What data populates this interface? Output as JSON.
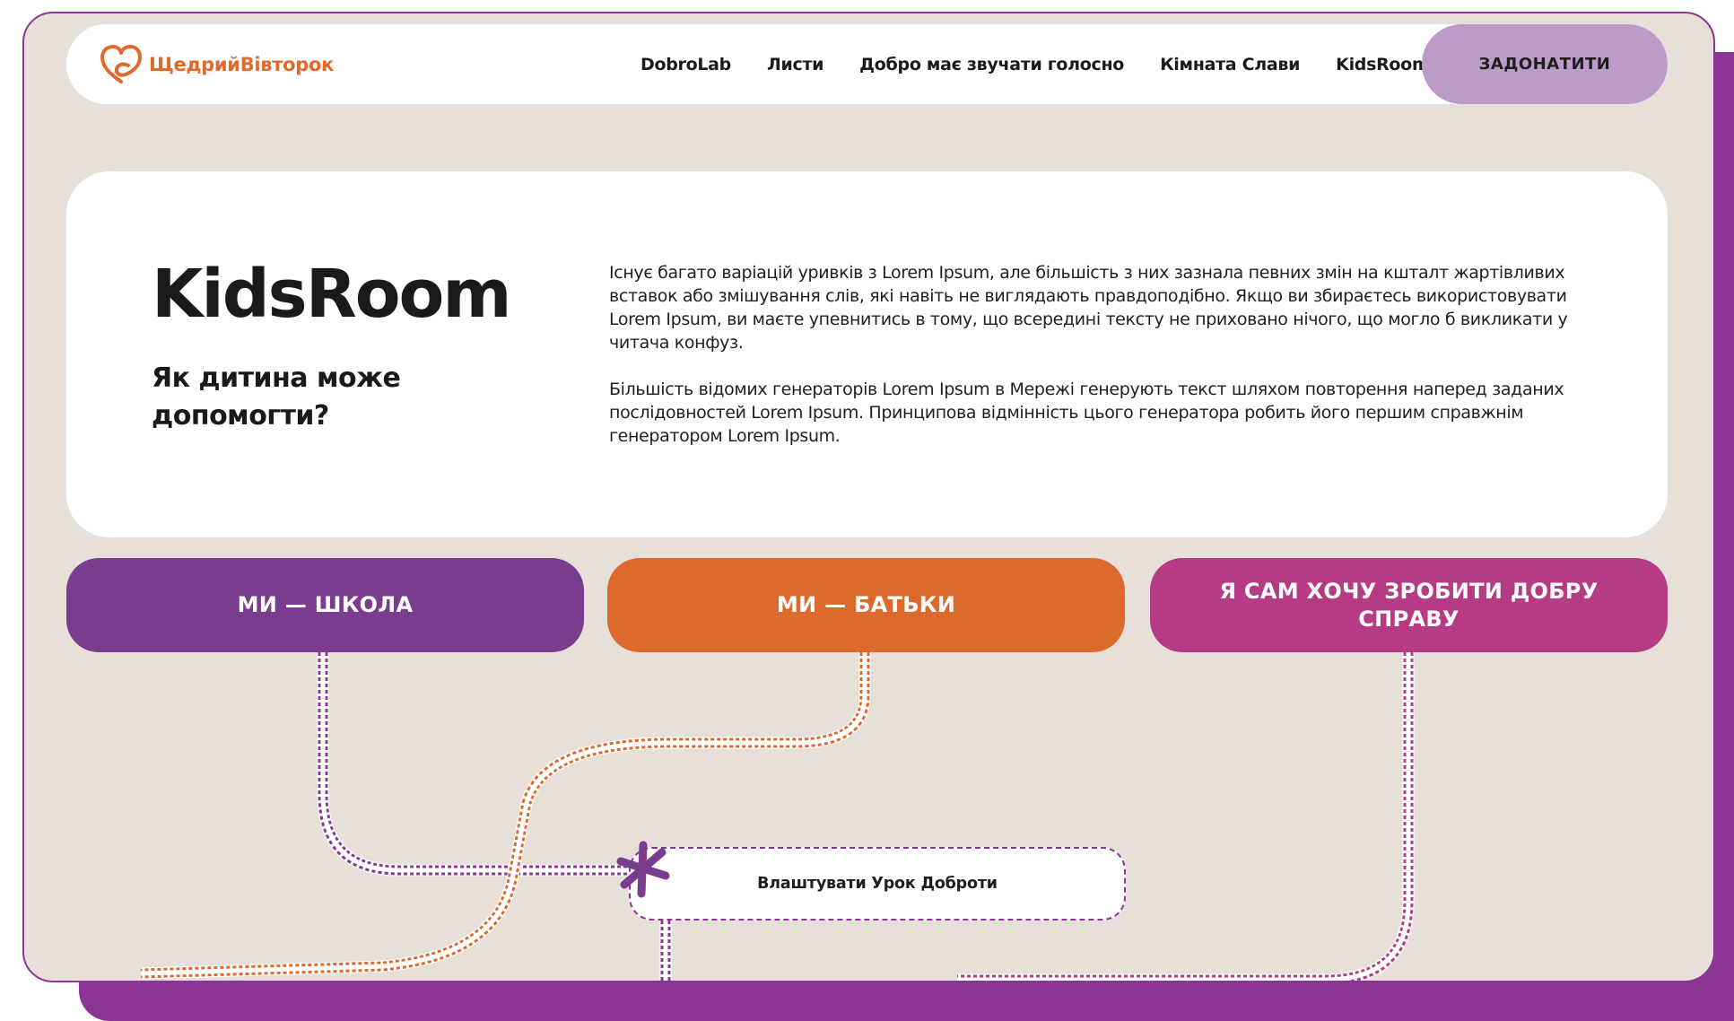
{
  "colors": {
    "brand_orange": "#e06a2c",
    "purple": "#7a3c8d",
    "orange": "#dc6a2c",
    "magenta": "#b53b85",
    "donate_bg": "#bd9bc8",
    "frame_purple": "#8b3596",
    "page_bg": "#e6e0d8"
  },
  "header": {
    "logo_text": "ЩедрийВівторок",
    "logo_icon": "heart-loop-icon",
    "nav": [
      "DobroLab",
      "Листи",
      "Добро має звучати голосно",
      "Кімната Слави",
      "KidsRoom"
    ],
    "donate_label": "ЗАДОНАТИТИ"
  },
  "hero": {
    "title": "KidsRoom",
    "subtitle": "Як дитина може допомогти?",
    "paragraphs": [
      "Існує багато варіацій уривків з Lorem Ipsum, але більшість з них зазнала певних змін на кшталт жартівливих вставок або змішування слів, які навіть не виглядають правдоподібно. Якщо ви збираєтесь використовувати Lorem Ipsum, ви маєте упевнитись в тому, що всередині тексту не приховано нічого, що могло б викликати у читача конфуз.",
      "Більшість відомих генераторів Lorem Ipsum в Мережі генерують текст шляхом повторення наперед заданих послідовностей Lorem Ipsum. Принципова відмінність цього генератора робить його першим справжнім генератором Lorem Ipsum."
    ]
  },
  "categories": {
    "school": "МИ — ШКОЛА",
    "parents": "МИ — БАТЬКИ",
    "self": "Я САМ ХОЧУ ЗРОБИТИ ДОБРУ СПРАВУ"
  },
  "path": {
    "step_label": "Влаштувати Урок Доброти",
    "marker_icon": "asterisk-icon"
  }
}
